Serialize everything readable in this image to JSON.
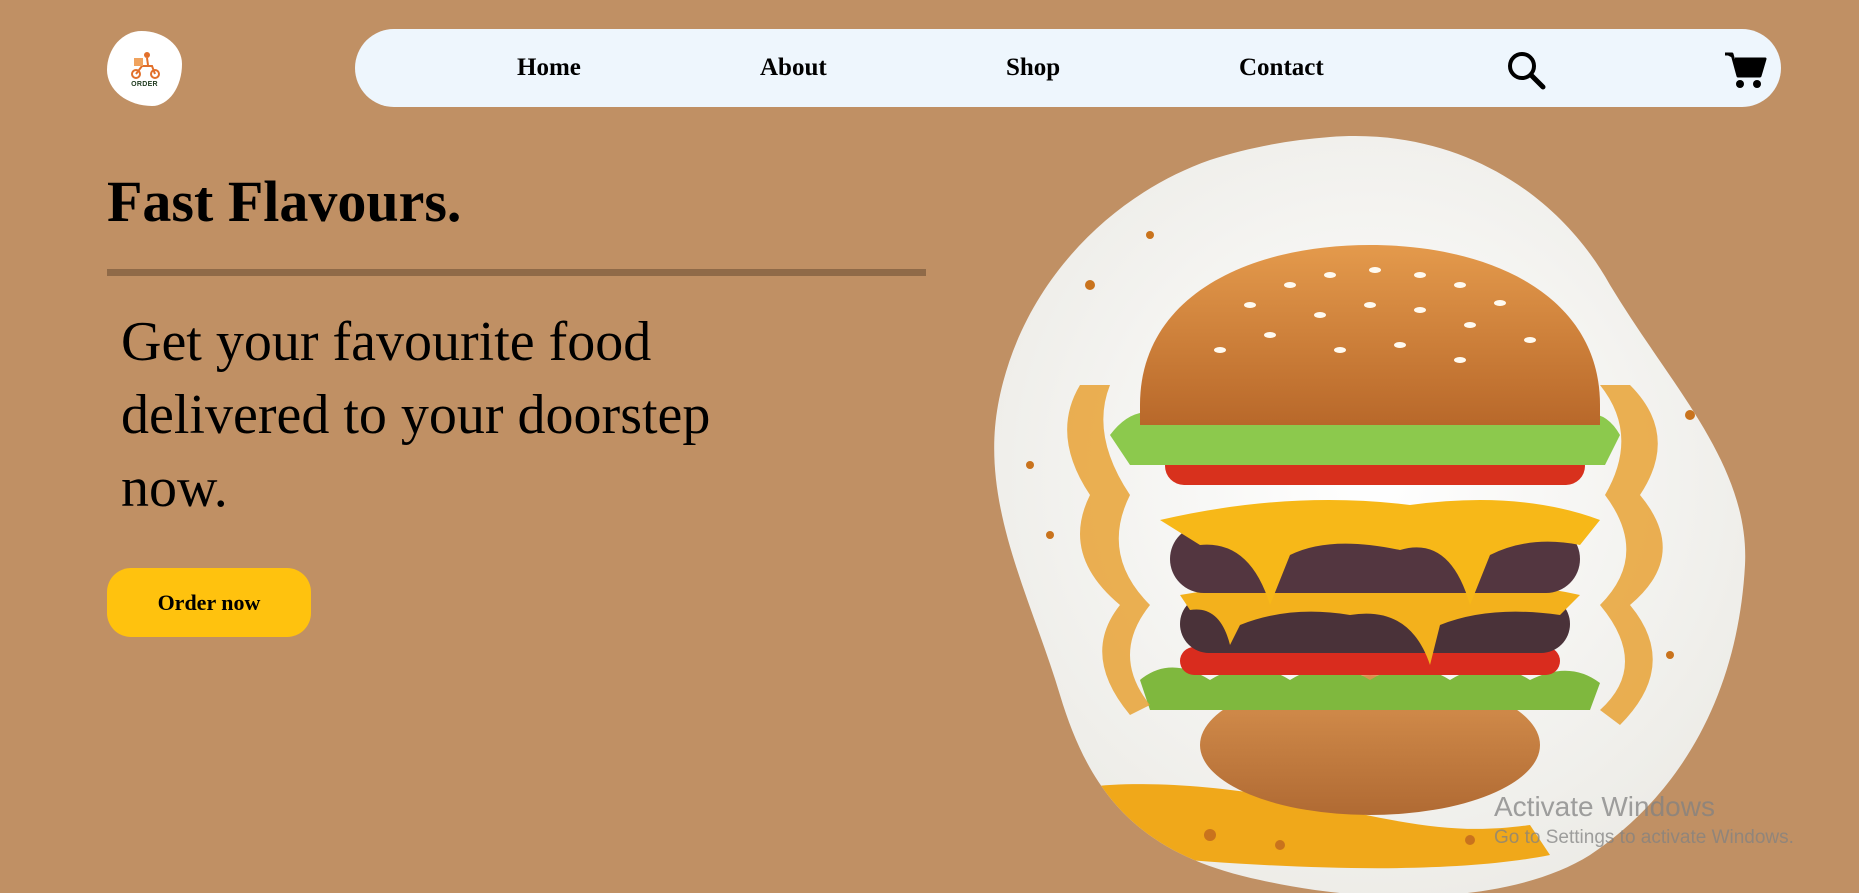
{
  "app": {
    "logo_text": "ORDER"
  },
  "nav": {
    "items": [
      {
        "label": "Home"
      },
      {
        "label": "About"
      },
      {
        "label": "Shop"
      },
      {
        "label": "Contact"
      }
    ],
    "icons": [
      "search-icon",
      "cart-icon"
    ]
  },
  "hero": {
    "title": "Fast Flavours.",
    "subtitle": "Get your favourite food delivered to your doorstep now.",
    "cta_label": "Order now",
    "image": "burger-image"
  },
  "watermark": {
    "title": "Activate Windows",
    "subtitle": "Go to Settings to activate Windows."
  },
  "colors": {
    "background": "#c09064",
    "navbar": "#eef6fd",
    "divider": "#8f6a48",
    "cta": "#ffc20e"
  }
}
